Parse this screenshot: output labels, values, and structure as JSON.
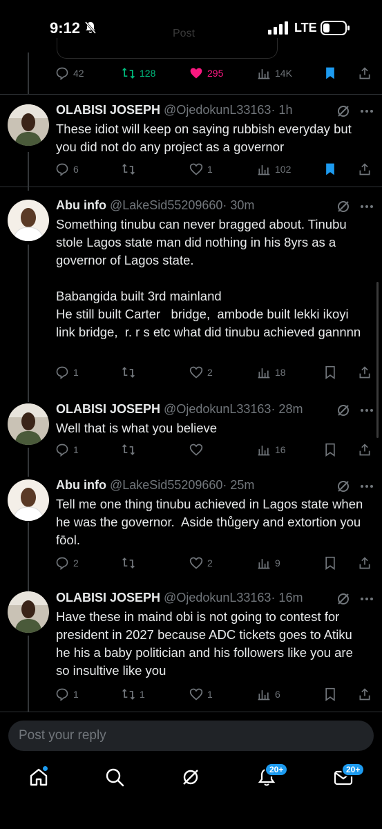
{
  "status_bar": {
    "time": "9:12",
    "network": "LTE"
  },
  "faded_header": "Post",
  "top_post_actions": {
    "replies": "42",
    "reposts": "128",
    "likes": "295",
    "views": "14K"
  },
  "tweets": [
    {
      "name": "OLABISI JOSEPH",
      "handle": "@OjedokunL33163",
      "time": "· 1h",
      "text": "These idiot will keep on saying rubbish everyday but you did not do any project as a governor",
      "replies": "6",
      "reposts": "",
      "likes": "1",
      "views": "102",
      "bookmarked": true
    },
    {
      "name": "Abu info",
      "handle": "@LakeSid55209660",
      "time": "· 30m",
      "text": "Something tinubu can never bragged about. Tinubu stole Lagos state man did nothing in his 8yrs as a governor of Lagos state.\n\nBabangida built 3rd mainland\nHe still built Carter   bridge,  ambode built lekki ikoyi link bridge,  r. r s etc what did tinubu achieved gannnn",
      "replies": "1",
      "reposts": "",
      "likes": "2",
      "views": "18",
      "bookmarked": false
    },
    {
      "name": "OLABISI JOSEPH",
      "handle": "@OjedokunL33163",
      "time": "· 28m",
      "text": "Well that is what you believe",
      "replies": "1",
      "reposts": "",
      "likes": "",
      "views": "16",
      "bookmarked": false
    },
    {
      "name": "Abu info",
      "handle": "@LakeSid55209660",
      "time": "· 25m",
      "text": "Tell me one thing tinubu achieved in Lagos state when he was the governor.  Aside thůgery and extortion you fōol.",
      "replies": "2",
      "reposts": "",
      "likes": "2",
      "views": "9",
      "bookmarked": false
    },
    {
      "name": "OLABISI JOSEPH",
      "handle": "@OjedokunL33163",
      "time": "· 16m",
      "text": "Have these in maind obi is not going to contest for president in 2027 because ADC tickets goes to Atiku he his a baby politician and his followers like you are so insultive like you",
      "replies": "1",
      "reposts": "1",
      "likes": "1",
      "views": "6",
      "bookmarked": false
    }
  ],
  "reply_box": {
    "placeholder": "Post your reply"
  },
  "tabbar": {
    "notifications_badge": "20+",
    "messages_badge": "20+"
  },
  "colors": {
    "accent": "#1d9bf0",
    "like": "#f91880",
    "repost": "#00ba7c",
    "muted": "#71767b"
  }
}
